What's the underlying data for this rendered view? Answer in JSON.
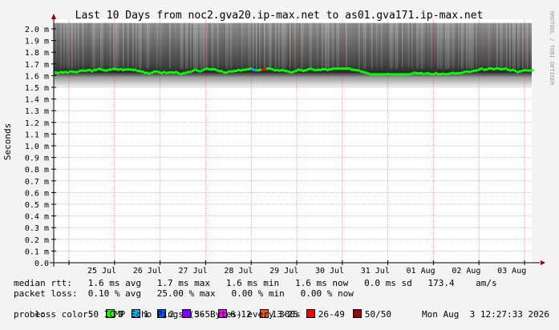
{
  "chart_data": {
    "type": "line",
    "title": "Last 10 Days from noc2.gva20.ip-max.net to as01.gva171.ip-max.net",
    "xlabel": "",
    "ylabel": "Seconds",
    "ylim": [
      0,
      2.05
    ],
    "y_ticks": [
      "0.0",
      "0.1 m",
      "0.2 m",
      "0.3 m",
      "0.4 m",
      "0.5 m",
      "0.6 m",
      "0.7 m",
      "0.8 m",
      "0.9 m",
      "1.0 m",
      "1.1 m",
      "1.2 m",
      "1.3 m",
      "1.4 m",
      "1.5 m",
      "1.6 m",
      "1.7 m",
      "1.8 m",
      "1.9 m",
      "2.0 m"
    ],
    "x_ticks": [
      "25 Jul",
      "26 Jul",
      "27 Jul",
      "28 Jul",
      "29 Jul",
      "30 Jul",
      "31 Jul",
      "01 Aug",
      "02 Aug",
      "03 Aug"
    ],
    "x_range": [
      "24 Jul",
      "03 Aug"
    ],
    "grid": true,
    "series": [
      {
        "name": "median rtt",
        "color": "#00ff00",
        "approx_level": 1.63,
        "range": [
          1.61,
          1.66
        ]
      },
      {
        "name": "smoke",
        "color": "#555555",
        "range_low": 1.5,
        "range_high": 2.05
      }
    ],
    "side_label": "RRDTOOL / TOBI OETIKER"
  },
  "legend": {
    "median_rtt": "median rtt:   1.6 ms avg   1.7 ms max   1.6 ms min   1.6 ms now   0.0 ms sd   173.4    am/s",
    "packet_loss": "packet loss:  0.10 % avg   25.00 % max   0.00 % min   0.00 % now",
    "loss_color_label": "loss color:",
    "loss_colors": [
      {
        "label": "0",
        "color": "#26ff00"
      },
      {
        "label": "1",
        "color": "#00b8ff"
      },
      {
        "label": "2",
        "color": "#0059ff"
      },
      {
        "label": "3-5",
        "color": "#7e00ff"
      },
      {
        "label": "6-12",
        "color": "#ff00ff"
      },
      {
        "label": "13-25",
        "color": "#ff5500"
      },
      {
        "label": "26-49",
        "color": "#ff0000"
      },
      {
        "label": "50/50",
        "color": "#a10000"
      }
    ],
    "probe": "probe:        50 ICMP Echo Pings (56 Bytes) every 300s",
    "timestamp": "Mon Aug  3 12:27:33 2026"
  }
}
